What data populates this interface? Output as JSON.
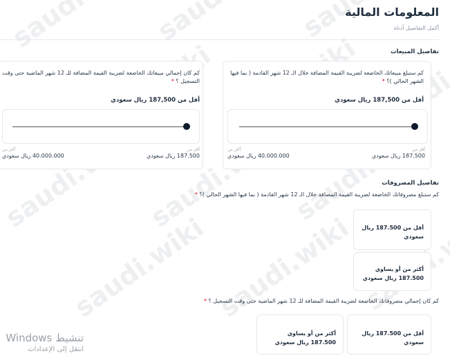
{
  "header": {
    "title": "المعلومات المالية",
    "subtitle": "أكمل التفاصيل أدناه"
  },
  "sales": {
    "section_title": "تفاصيل المبيعات",
    "card_next": {
      "question": "كم ستبلغ مبيعاتك الخاضعة لضريبة القيمة المضافة خلال الـ 12 شهر القادمة ( بما فيها الشهر الحالي )؟",
      "required": "*",
      "answer": "أقل من 187,500 ريال سعودي",
      "min_caption": "أقل من",
      "min_value": "187.500 ريال سعودي",
      "max_caption": "أكثر من",
      "max_value": "40.000.000 ريال سعودي"
    },
    "card_past": {
      "question": "كم كان إجمالي مبيعاتك الخاضعة لضريبة القيمة المضافة للـ 12 شهر الماضية حتى وقت التسجيل ؟",
      "required": "*",
      "answer": "أقل من 187,500 ريال سعودي",
      "min_caption": "أقل من",
      "min_value": "187.500 ريال سعودي",
      "max_caption": "أكثر من",
      "max_value": "40.000.000 ريال سعودي"
    }
  },
  "expenses": {
    "section_title": "تفاصيل المصروفات",
    "q1": "كم ستبلغ مصروفاتك الخاضعة لضريبة القيمة المضافة خلال الـ 12 شهر القادمة ( بما فيها الشهر الحالي )؟",
    "q1_required": "*",
    "q1_options": [
      "أقل من 187.500 ريال سعودي",
      "أكثر من أو يساوي 187.500 ريال سعودي"
    ],
    "q2": "كم كان إجمالي مصروفاتك الخاضعة لضريبة القيمة المضافة للـ 12 شهر الماضية حتى وقت التسجيل ؟",
    "q2_required": "*",
    "q2_options": [
      "أقل من 187.500 ريال سعودي",
      "أكثر من أو يساوي 187.500 ريال سعودي"
    ]
  },
  "windows_watermark": {
    "line1": "تنشيط Windows",
    "line2": "انتقل إلى الإعدادات"
  },
  "watermark_text": "saudi.wiki",
  "colors": {
    "text": "#1f2d3d",
    "required": "#e0001b",
    "border": "#e4e7ec",
    "knob": "#0f1a2b"
  }
}
